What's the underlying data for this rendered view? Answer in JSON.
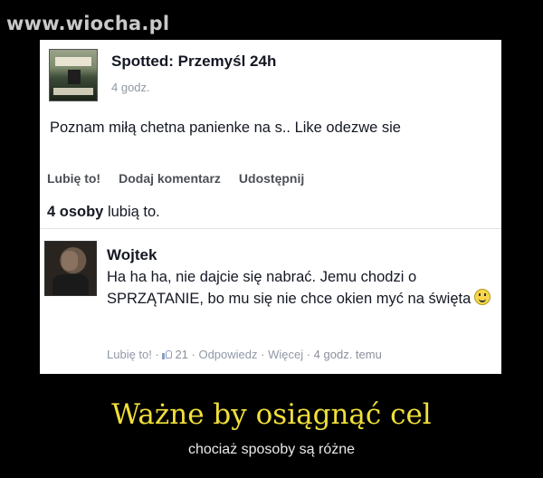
{
  "watermark": "www.wiocha.pl",
  "post": {
    "page_name": "Spotted: Przemyśl 24h",
    "time": "4 godz.",
    "text": "Poznam miłą chetna panienke na s.. Like odezwe sie",
    "actions": [
      "Lubię to!",
      "Dodaj komentarz",
      "Udostępnij"
    ],
    "likes_bold": "4 osoby",
    "likes_rest": " lubią to."
  },
  "comment": {
    "author": "Wojtek",
    "text": "Ha ha ha, nie dajcie się nabrać. Jemu chodzi o SPRZĄTANIE, bo mu się nie chce okien myć na święta",
    "like_label": "Lubię to!",
    "like_count": "21",
    "reply_label": "Odpowiedz",
    "more_label": "Więcej",
    "time": "4 godz. temu",
    "separator": " · "
  },
  "caption": {
    "title": "Ważne by osiągnąć cel",
    "subtitle": "chociaż sposoby są różne"
  },
  "colors": {
    "title": "#f0df3a",
    "background": "#000000",
    "card": "#ffffff",
    "meta": "#8b909a"
  }
}
